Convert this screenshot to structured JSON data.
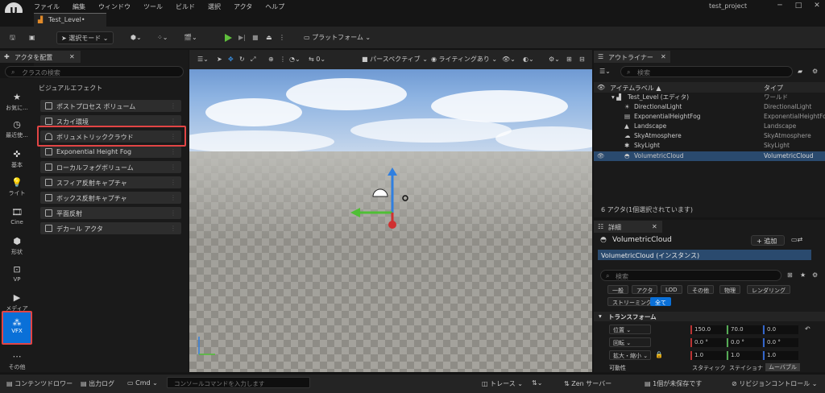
{
  "app": {
    "logo": "U",
    "project": "test_project"
  },
  "menu": [
    "ファイル",
    "編集",
    "ウィンドウ",
    "ツール",
    "ビルド",
    "選択",
    "アクタ",
    "ヘルプ"
  ],
  "level_tab": "Test_Level•",
  "toolbar": {
    "select_mode": "選択モード",
    "platform": "プラットフォーム"
  },
  "place_panel": {
    "tab": "アクタを配置",
    "search_placeholder": "クラスの検索",
    "category_header": "ビジュアルエフェクト",
    "items": [
      "ポストプロセス ボリューム",
      "スカイ環境",
      "ボリュメトリッククラウド",
      "Exponential Height Fog",
      "ローカルフォグボリューム",
      "スフィア反射キャプチャ",
      "ボックス反射キャプチャ",
      "平面反射",
      "デカール アクタ"
    ]
  },
  "iconbar": [
    {
      "icon": "star-icon",
      "label": "お気に..."
    },
    {
      "icon": "clock-icon",
      "label": "最近使..."
    },
    {
      "icon": "basic-icon",
      "label": "基本"
    },
    {
      "icon": "light-icon",
      "label": "ライト"
    },
    {
      "icon": "cine-icon",
      "label": "Cine"
    },
    {
      "icon": "shape-icon",
      "label": "形状"
    },
    {
      "icon": "vp-icon",
      "label": "VP"
    },
    {
      "icon": "media-icon",
      "label": "メディア"
    },
    {
      "icon": "vfx-icon",
      "label": "VFX"
    },
    {
      "icon": "more-icon",
      "label": "その他"
    }
  ],
  "viewport": {
    "perspective": "パースペクティブ",
    "lighting": "ライティングあり",
    "speed": "0"
  },
  "outliner": {
    "tab": "アウトライナー",
    "search_placeholder": "検索",
    "col_label": "アイテムラベル ▲",
    "col_type": "タイプ",
    "rows": [
      {
        "name": "Test_Level (エディタ)",
        "type": "ワールド"
      },
      {
        "name": "DirectionalLight",
        "type": "DirectionalLight"
      },
      {
        "name": "ExponentialHeightFog",
        "type": "ExponentialHeightFo"
      },
      {
        "name": "Landscape",
        "type": "Landscape"
      },
      {
        "name": "SkyAtmosphere",
        "type": "SkyAtmosphere"
      },
      {
        "name": "SkyLight",
        "type": "SkyLight"
      },
      {
        "name": "VolumetricCloud",
        "type": "VolumetricCloud"
      }
    ],
    "count": "6 アクタ(1個選択されています)"
  },
  "details": {
    "tab": "詳細",
    "title": "VolumetricCloud",
    "add": "+ 追加",
    "instance": "VolumetricCloud (インスタンス)",
    "search_placeholder": "検索",
    "chips": [
      "一般",
      "アクタ",
      "LOD",
      "その他",
      "物理",
      "レンダリング",
      "ストリーミング",
      "全て"
    ],
    "transform_header": "トランスフォーム",
    "location": {
      "label": "位置",
      "x": "150.0",
      "y": "70.0",
      "z": "0.0"
    },
    "rotation": {
      "label": "回転",
      "x": "0.0 °",
      "y": "0.0 °",
      "z": "0.0 °"
    },
    "scale": {
      "label": "拡大・縮小",
      "x": "1.0",
      "y": "1.0",
      "z": "1.0"
    },
    "mobility": {
      "label": "可動性",
      "opts": [
        "スタティック",
        "ステイショナ",
        "ムーバブル"
      ]
    }
  },
  "statusbar": {
    "content_drawer": "コンテンツドロワー",
    "output_log": "出力ログ",
    "cmd": "Cmd",
    "cmd_placeholder": "コンソールコマンドを入力します",
    "trace": "トレース",
    "zen": "Zen サーバー",
    "unsaved": "1個が未保存です",
    "revision": "リビジョンコントロール"
  }
}
